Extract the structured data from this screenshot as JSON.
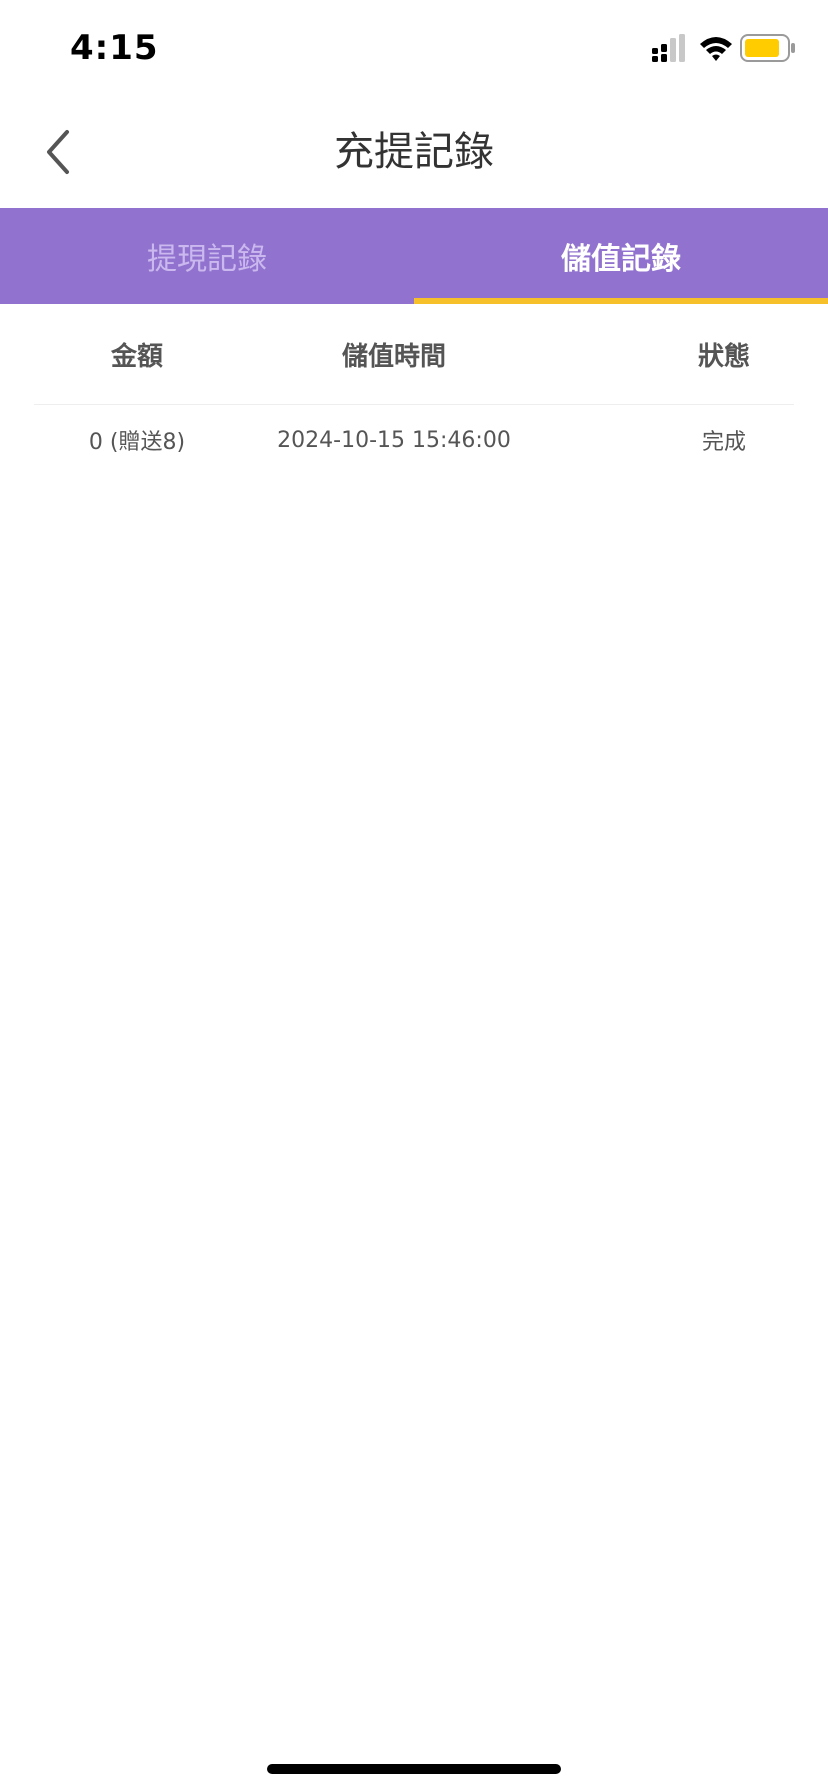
{
  "status_bar": {
    "time": "4:15"
  },
  "header": {
    "title": "充提記錄",
    "back_icon": "chevron-left-icon"
  },
  "tabs": [
    {
      "label": "提現記錄",
      "active": false
    },
    {
      "label": "儲值記錄",
      "active": true
    }
  ],
  "table": {
    "columns": [
      "金額",
      "儲值時間",
      "狀態"
    ],
    "rows": [
      {
        "amount": "0 (贈送8)",
        "time": "2024-10-15 15:46:00",
        "status": "完成"
      }
    ]
  },
  "colors": {
    "tab_background": "#9173CF",
    "tab_indicator": "#F5C02A",
    "battery_fill": "#FFCC00"
  }
}
